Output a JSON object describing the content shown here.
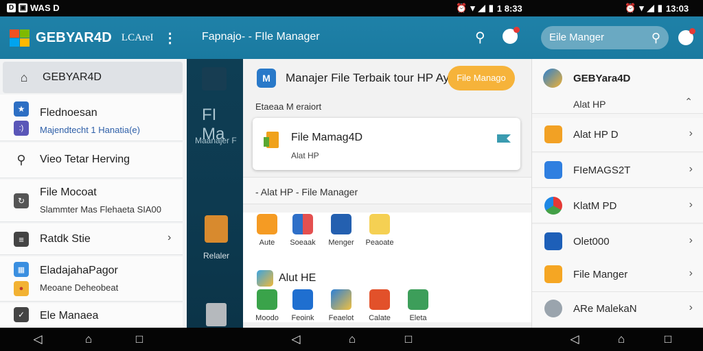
{
  "status_bar": {
    "left_text": "WAS D",
    "time_middle": "1 8:33",
    "time_right": "13:03"
  },
  "panel_left": {
    "title": "GEBYAR4D",
    "subtitle": "LCAreI",
    "items": [
      {
        "label": "GEBYAR4D",
        "sublabel": ""
      },
      {
        "label": "Flednoesan",
        "sublabel": "Majendtecht 1 Hanatia(e)"
      },
      {
        "label": "Vieo Tetar Herving",
        "sublabel": ""
      },
      {
        "label": "File Mocoat",
        "sublabel": "Slammter Mas Flehaeta SIA00"
      },
      {
        "label": "Ratdk Stie",
        "sublabel": ""
      },
      {
        "label": "EladajahaPagor",
        "sublabel": "Meoane Deheobeat"
      },
      {
        "label": "Ele Manaea",
        "sublabel": ""
      }
    ]
  },
  "dark_strip": {
    "text1": "FI Ma",
    "text2": "Maanajer F",
    "text3": "Relaler"
  },
  "panel_middle": {
    "title": "Fapnajo- - FIle Manager",
    "hero_text": "Manajer File Terbaik tour HP Aya",
    "hero_button": "File Manago",
    "section_label": "Etaeaa M eraiort",
    "card": {
      "title": "File Mamag4D",
      "subtitle": "Alat HP"
    },
    "divider_text": "- Alat HP - File Manager",
    "apps_row1": [
      "Aute",
      "Soeaak",
      "Menger",
      "Peaoate"
    ],
    "alt_label": "Alut HE",
    "apps_row2": [
      "Moodo",
      "Feoink",
      "Feaelot",
      "Calate",
      "Eleta"
    ]
  },
  "panel_right": {
    "search_text": "Eile Manger",
    "header_item": {
      "title": "GEBYara4D",
      "sublabel": "Alat HP"
    },
    "items": [
      {
        "label": "Alat HP D"
      },
      {
        "label": "FIeMAGS2T"
      },
      {
        "label": "KlatM PD"
      },
      {
        "label": "Olet000"
      },
      {
        "label": "File Manger"
      },
      {
        "label": "ARe MalekaN"
      }
    ]
  },
  "nav": {
    "back": "◁",
    "home": "⌂",
    "recent": "□"
  },
  "colors": {
    "header": "#1a7aa0",
    "accent_orange": "#f6b33a",
    "dark_strip": "#0d3a50"
  }
}
